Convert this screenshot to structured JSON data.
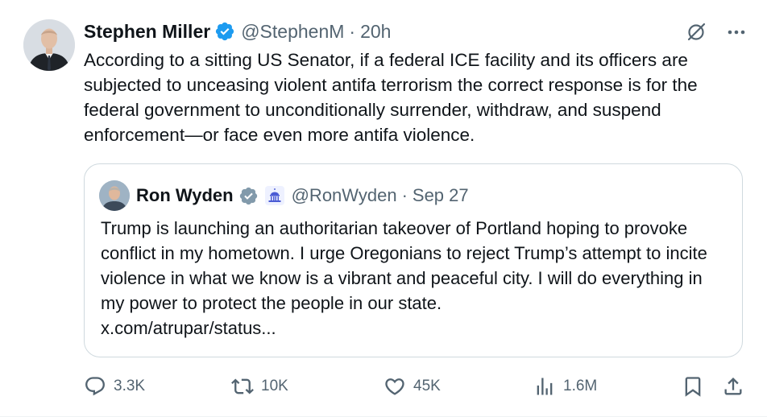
{
  "author": {
    "name": "Stephen Miller",
    "handle": "@StephenM",
    "separator": "·",
    "time": "20h"
  },
  "post_text": "According to a sitting US Senator, if a federal ICE facility and its officers are subjected to unceasing violent antifa terrorism the correct response is for the federal government to unconditionally surrender, withdraw, and suspend enforcement—or face even more antifa violence.",
  "quoted": {
    "name": "Ron Wyden",
    "handle": "@RonWyden",
    "separator": "·",
    "time": "Sep 27",
    "text": "Trump is launching an authoritarian takeover of Portland hoping to provoke conflict in my hometown. I urge Oregonians to reject Trump’s attempt to incite violence in what we know is a vibrant and peaceful city. I will do everything in my power to protect the people in our state.",
    "link": "x.com/atrupar/status..."
  },
  "metrics": {
    "replies": "3.3K",
    "reposts": "10K",
    "likes": "45K",
    "views": "1.6M"
  },
  "icons": {
    "verified": "blue-checkmark-icon",
    "quoted_verified": "gray-checkmark-icon",
    "government": "capitol-building-icon",
    "grok": "grok-icon",
    "more": "more-dots-icon",
    "reply": "reply-icon",
    "repost": "repost-icon",
    "like": "heart-icon",
    "views": "views-icon",
    "bookmark": "bookmark-icon",
    "share": "share-icon"
  },
  "colors": {
    "verified_blue": "#1d9bf0",
    "government_gray": "#829aab",
    "secondary_text": "#536471",
    "border": "#cfd9de"
  }
}
